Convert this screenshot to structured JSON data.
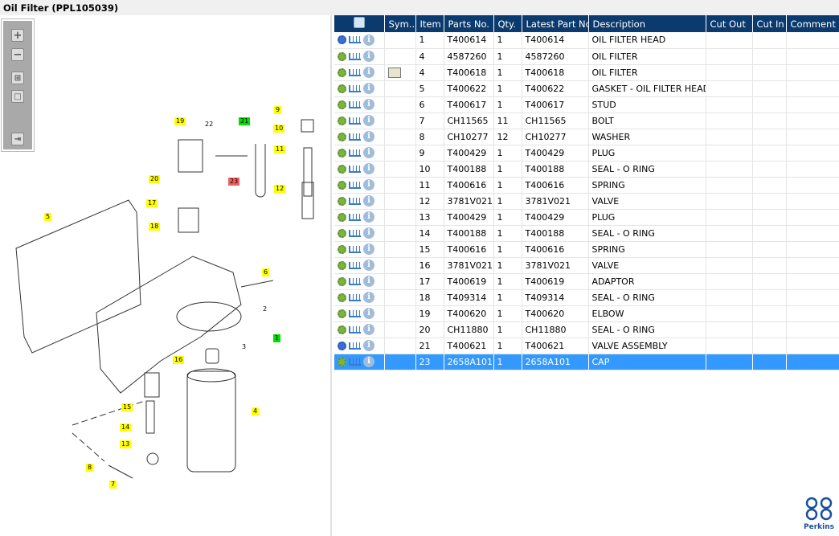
{
  "title": "Oil Filter (PPL105039)",
  "toolbar": {
    "zoom_in": "+",
    "zoom_out": "−",
    "fit": "⊞",
    "actual": "□",
    "panel": "⇥"
  },
  "callouts": [
    {
      "n": "19",
      "t": "y"
    },
    {
      "n": "22",
      "t": "p"
    },
    {
      "n": "21",
      "t": "g"
    },
    {
      "n": "23",
      "t": "r"
    },
    {
      "n": "9",
      "t": "y"
    },
    {
      "n": "10",
      "t": "y"
    },
    {
      "n": "11",
      "t": "y"
    },
    {
      "n": "12",
      "t": "y"
    },
    {
      "n": "20",
      "t": "y"
    },
    {
      "n": "17",
      "t": "y"
    },
    {
      "n": "18",
      "t": "y"
    },
    {
      "n": "5",
      "t": "y"
    },
    {
      "n": "6",
      "t": "y"
    },
    {
      "n": "2",
      "t": "p"
    },
    {
      "n": "3",
      "t": "p"
    },
    {
      "n": "1",
      "t": "g"
    },
    {
      "n": "16",
      "t": "y"
    },
    {
      "n": "15",
      "t": "y"
    },
    {
      "n": "14",
      "t": "y"
    },
    {
      "n": "13",
      "t": "y"
    },
    {
      "n": "8",
      "t": "y"
    },
    {
      "n": "7",
      "t": "y"
    },
    {
      "n": "4",
      "t": "y"
    }
  ],
  "columns": [
    "",
    "Sym...",
    "Item",
    "Parts No.",
    "Qty.",
    "Latest Part No.",
    "Description",
    "Cut Out",
    "Cut In",
    "Comment"
  ],
  "rows": [
    {
      "gear": "blue",
      "sym": "",
      "item": "1",
      "part": "T400614",
      "qty": "1",
      "latest": "T400614",
      "desc": "OIL FILTER HEAD"
    },
    {
      "gear": "green",
      "sym": "",
      "item": "4",
      "part": "4587260",
      "qty": "1",
      "latest": "4587260",
      "desc": "OIL FILTER"
    },
    {
      "gear": "green",
      "sym": "book",
      "item": "4",
      "part": "T400618",
      "qty": "1",
      "latest": "T400618",
      "desc": "OIL FILTER"
    },
    {
      "gear": "green",
      "sym": "",
      "item": "5",
      "part": "T400622",
      "qty": "1",
      "latest": "T400622",
      "desc": "GASKET - OIL FILTER HEAD"
    },
    {
      "gear": "green",
      "sym": "",
      "item": "6",
      "part": "T400617",
      "qty": "1",
      "latest": "T400617",
      "desc": "STUD"
    },
    {
      "gear": "green",
      "sym": "",
      "item": "7",
      "part": "CH11565",
      "qty": "11",
      "latest": "CH11565",
      "desc": "BOLT"
    },
    {
      "gear": "green",
      "sym": "",
      "item": "8",
      "part": "CH10277",
      "qty": "12",
      "latest": "CH10277",
      "desc": "WASHER"
    },
    {
      "gear": "green",
      "sym": "",
      "item": "9",
      "part": "T400429",
      "qty": "1",
      "latest": "T400429",
      "desc": "PLUG"
    },
    {
      "gear": "green",
      "sym": "",
      "item": "10",
      "part": "T400188",
      "qty": "1",
      "latest": "T400188",
      "desc": "SEAL - O RING"
    },
    {
      "gear": "green",
      "sym": "",
      "item": "11",
      "part": "T400616",
      "qty": "1",
      "latest": "T400616",
      "desc": "SPRING"
    },
    {
      "gear": "green",
      "sym": "",
      "item": "12",
      "part": "3781V021",
      "qty": "1",
      "latest": "3781V021",
      "desc": "VALVE"
    },
    {
      "gear": "green",
      "sym": "",
      "item": "13",
      "part": "T400429",
      "qty": "1",
      "latest": "T400429",
      "desc": "PLUG"
    },
    {
      "gear": "green",
      "sym": "",
      "item": "14",
      "part": "T400188",
      "qty": "1",
      "latest": "T400188",
      "desc": "SEAL - O RING"
    },
    {
      "gear": "green",
      "sym": "",
      "item": "15",
      "part": "T400616",
      "qty": "1",
      "latest": "T400616",
      "desc": "SPRING"
    },
    {
      "gear": "green",
      "sym": "",
      "item": "16",
      "part": "3781V021",
      "qty": "1",
      "latest": "3781V021",
      "desc": "VALVE"
    },
    {
      "gear": "green",
      "sym": "",
      "item": "17",
      "part": "T400619",
      "qty": "1",
      "latest": "T400619",
      "desc": "ADAPTOR"
    },
    {
      "gear": "green",
      "sym": "",
      "item": "18",
      "part": "T409314",
      "qty": "1",
      "latest": "T409314",
      "desc": "SEAL - O RING"
    },
    {
      "gear": "green",
      "sym": "",
      "item": "19",
      "part": "T400620",
      "qty": "1",
      "latest": "T400620",
      "desc": "ELBOW"
    },
    {
      "gear": "green",
      "sym": "",
      "item": "20",
      "part": "CH11880",
      "qty": "1",
      "latest": "CH11880",
      "desc": "SEAL - O RING"
    },
    {
      "gear": "blue",
      "sym": "",
      "item": "21",
      "part": "T400621",
      "qty": "1",
      "latest": "T400621",
      "desc": "VALVE ASSEMBLY"
    },
    {
      "gear": "green",
      "sym": "",
      "item": "23",
      "part": "2658A101",
      "qty": "1",
      "latest": "2658A101",
      "desc": "CAP",
      "selected": true
    }
  ],
  "logo": "Perkins",
  "colors": {
    "header": "#0a3a6e",
    "selected": "#3399ff",
    "callout": "#ffff00"
  }
}
